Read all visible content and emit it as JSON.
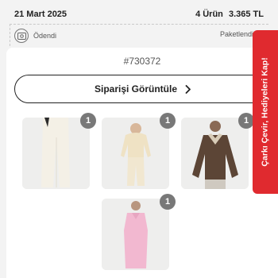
{
  "order": {
    "date": "21 Mart 2025",
    "item_count": "4 Ürün",
    "total": "3.365 TL",
    "order_number": "#730372"
  },
  "tracker": {
    "start_label": "Ödendi",
    "end_label": "Paketlendi"
  },
  "actions": {
    "view_order_label": "Siparişi Görüntüle"
  },
  "products": [
    {
      "quantity": "1"
    },
    {
      "quantity": "1"
    },
    {
      "quantity": "1"
    },
    {
      "quantity": "1"
    }
  ],
  "promo": {
    "label": "Çarkı Çevir, Hediyeleri Kap!",
    "color": "#e02a2f"
  },
  "icons": [
    "payment-icon",
    "package-icon",
    "chevron-right-icon"
  ]
}
